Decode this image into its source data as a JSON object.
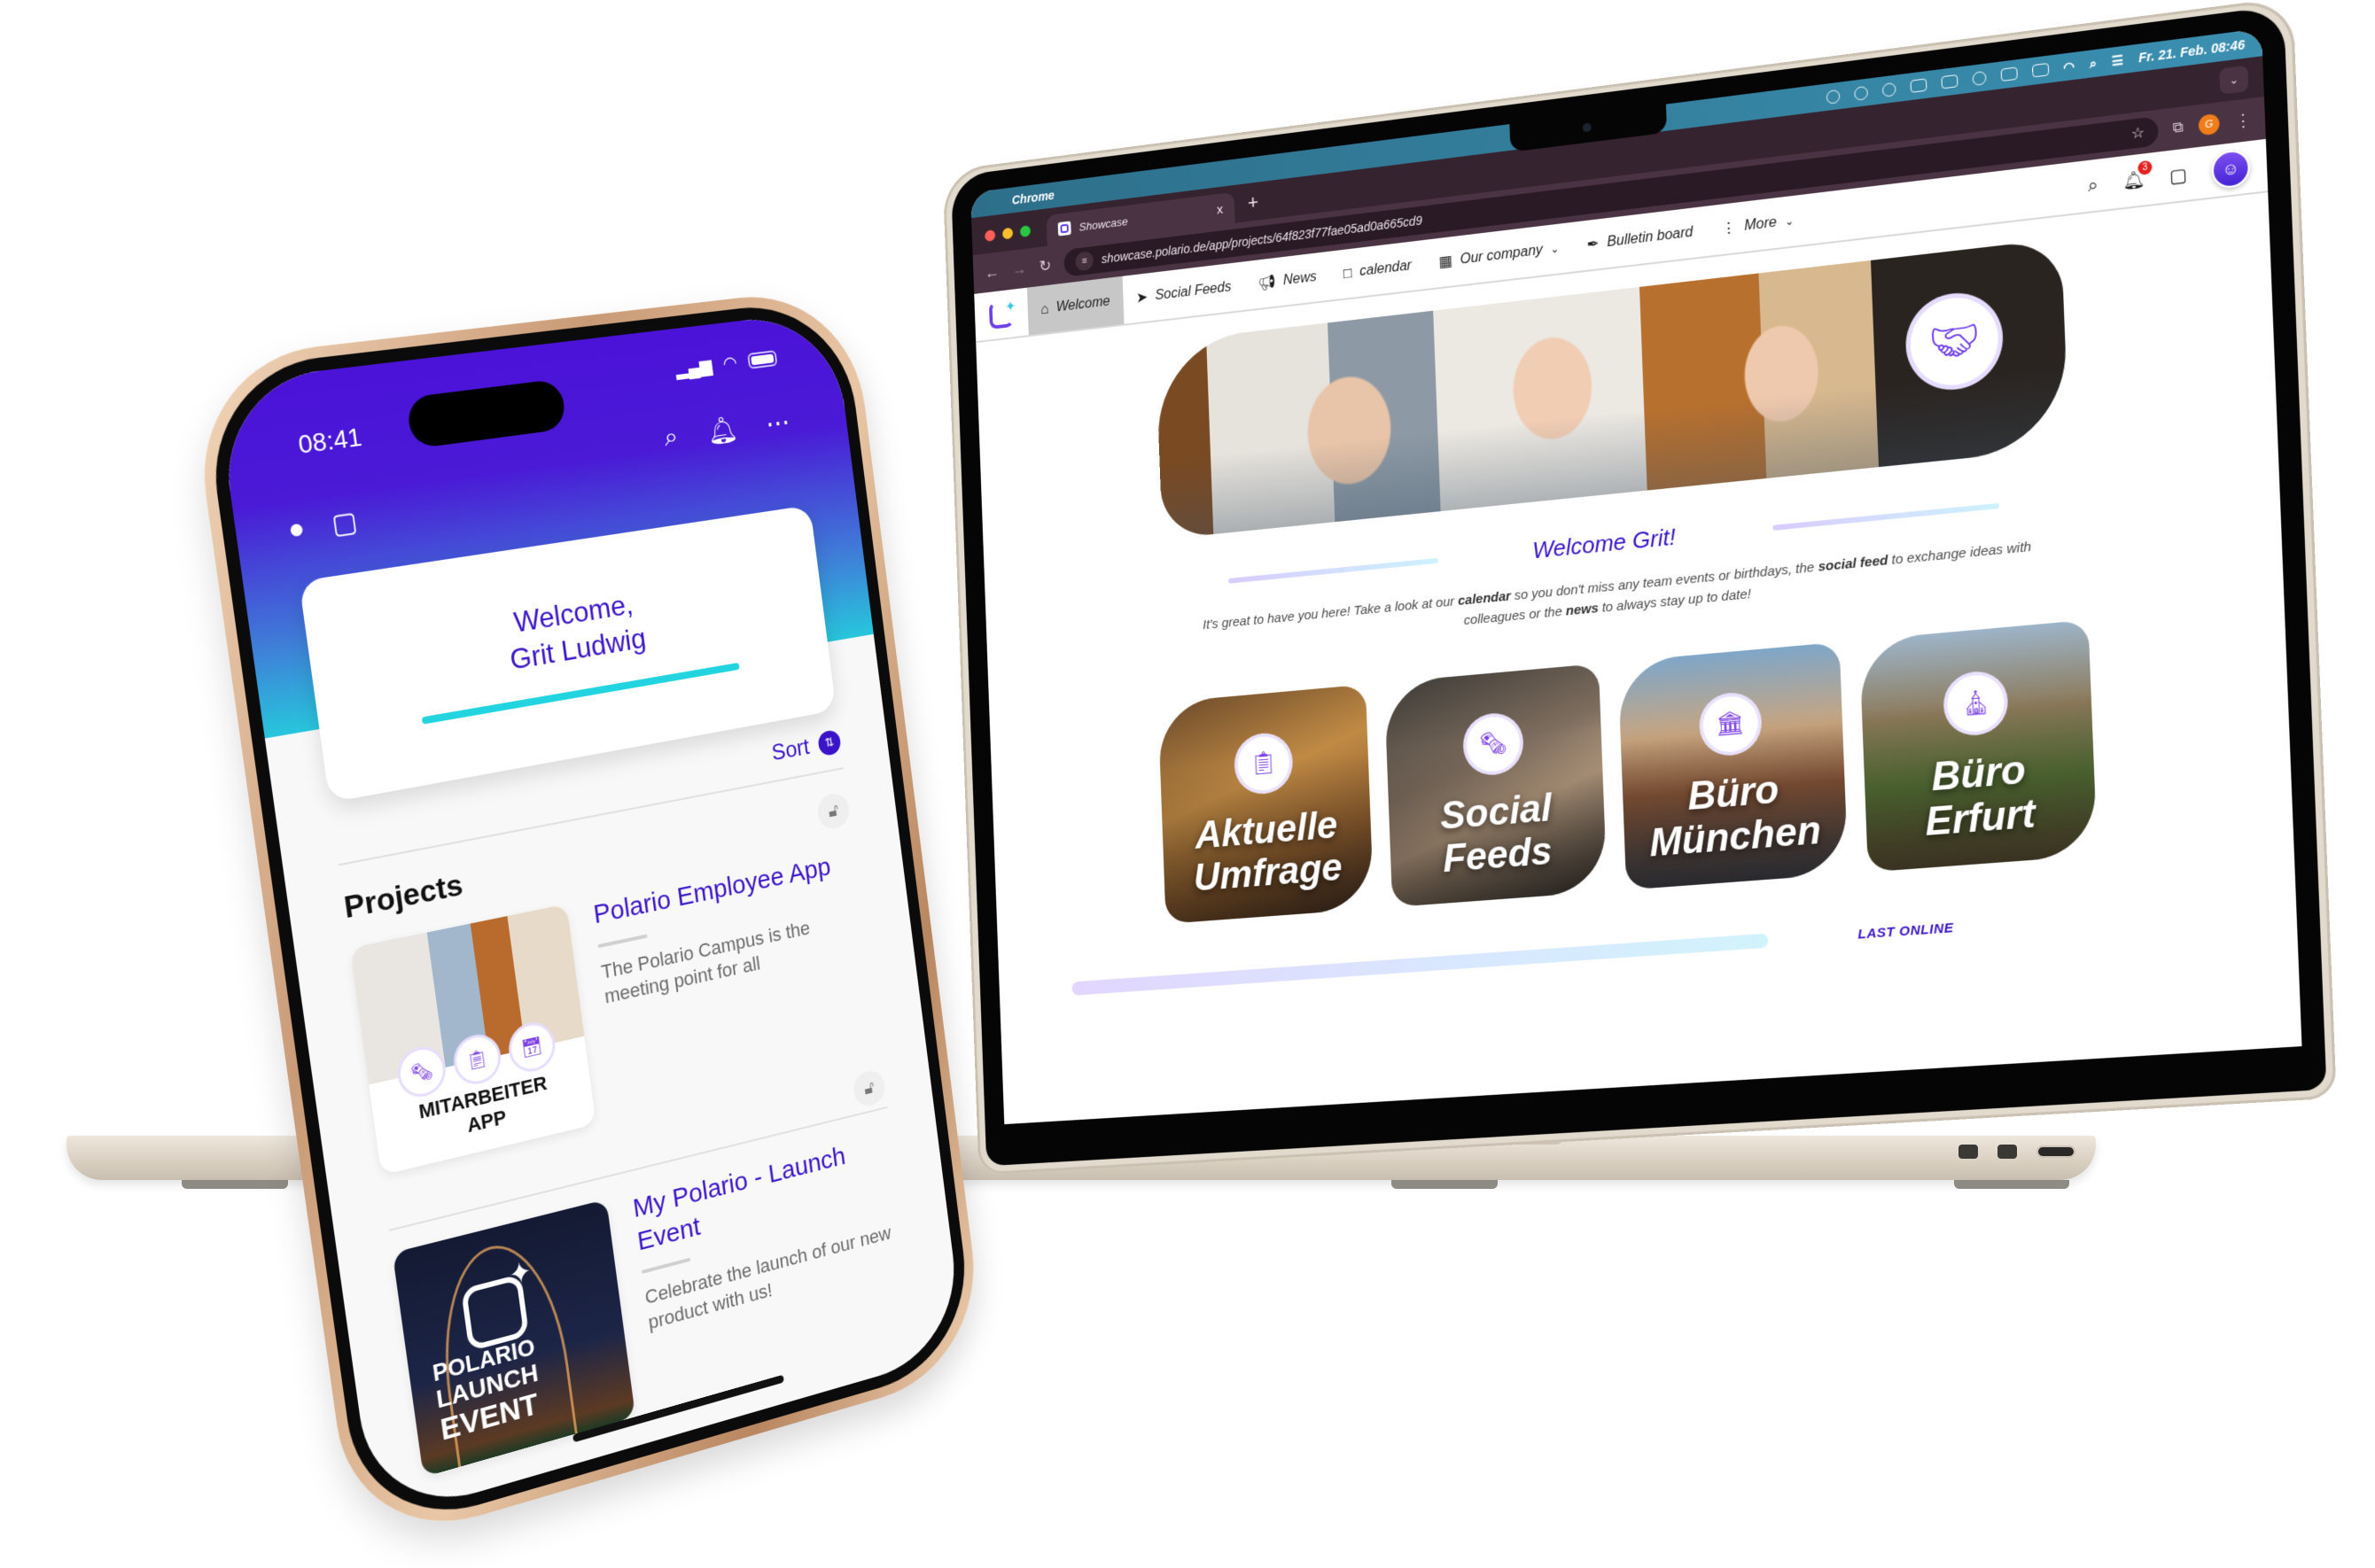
{
  "laptop": {
    "menubar": {
      "app_name": "Chrome",
      "datetime": "Fr. 21. Feb. 08:46"
    },
    "browser": {
      "tab_title": "Showcase",
      "tab_close": "x",
      "new_tab": "+",
      "url": "showcase.polario.de/app/projects/64f823f77fae05ad0a665cd9",
      "profile_initial": "G"
    },
    "app_nav": {
      "items": [
        {
          "label": "Welcome",
          "icon": "home-icon",
          "active": true
        },
        {
          "label": "Social Feeds",
          "icon": "paper-plane-icon"
        },
        {
          "label": "News",
          "icon": "megaphone-icon"
        },
        {
          "label": "calendar",
          "icon": "calendar-icon"
        },
        {
          "label": "Our company",
          "icon": "buildings-icon",
          "has_dropdown": true
        },
        {
          "label": "Bulletin board",
          "icon": "pin-icon"
        },
        {
          "label": "More",
          "icon": "more-vertical-icon",
          "has_dropdown": true
        }
      ],
      "notification_count": "3"
    },
    "page": {
      "welcome_title": "Welcome Grit!",
      "intro_parts": {
        "p1": "It's great to have you here! Take a look at our ",
        "calendar": "calendar",
        "p2": " so you don't miss any team events or birthdays, the ",
        "social_feed": "social feed",
        "p3": " to exchange ideas with colleagues or the ",
        "news": "news",
        "p4": " to always stay up to date!"
      },
      "tiles": [
        {
          "label_1": "Aktuelle",
          "label_2": "Umfrage",
          "icon": "clipboard-icon"
        },
        {
          "label_1": "Social",
          "label_2": "Feeds",
          "icon": "news-feed-icon"
        },
        {
          "label_1": "Büro",
          "label_2": "München",
          "icon": "city-building-icon"
        },
        {
          "label_1": "Büro",
          "label_2": "Erfurt",
          "icon": "church-building-icon"
        }
      ],
      "last_online": "LAST ONLINE"
    }
  },
  "phone": {
    "time": "08:41",
    "welcome_line_1": "Welcome,",
    "welcome_line_2": "Grit Ludwig",
    "sort_label": "Sort",
    "projects_heading": "Projects",
    "projects": [
      {
        "title": "Polario Employee App",
        "description": "The Polario Campus is the meeting point for all",
        "thumb_caption_1": "MITARBEITER",
        "thumb_caption_2": "APP"
      },
      {
        "title": "My Polario - Launch Event",
        "description": "Celebrate the launch of our new product with us!",
        "thumb_caption_1": "POLARIO",
        "thumb_caption_2": "LAUNCH",
        "thumb_caption_3": "EVENT"
      }
    ]
  },
  "colors": {
    "brand_purple": "#3814c9",
    "accent_cyan": "#22d3e0",
    "badge_red": "#e52020"
  }
}
